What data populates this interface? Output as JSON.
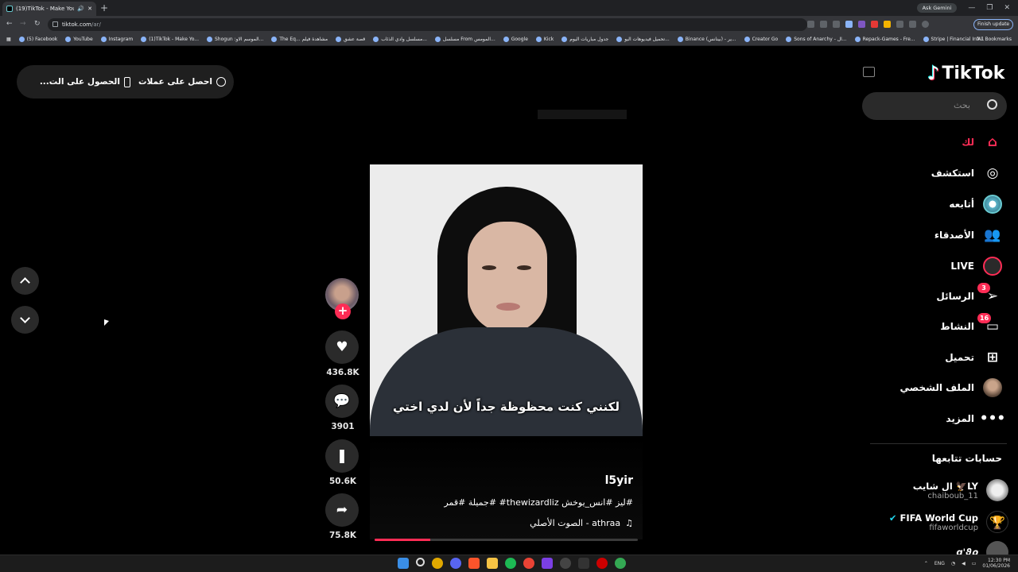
{
  "browser": {
    "tab_title": "(19)TikTok - Make Your Day",
    "ask_gemini": "Ask Gemini",
    "url_host": "tiktok.com",
    "url_path": "/ar/",
    "finish_update": "Finish update",
    "all_bookmarks": "All Bookmarks",
    "bookmarks": [
      "(5) Facebook",
      "YouTube",
      "Instagram",
      "(1)TikTok - Make Yo...",
      "Shogun :الموسم الاو...",
      "The Eq... مشاهدة فيلم",
      "قصة عشق",
      "مسلسل وادي الذئاب...",
      "مسلسل From المومس...",
      "Google",
      "Kick",
      "جدول مباريات اليوم",
      "تحميل فيديوهات اليو...",
      "Binance (بينانس) - ير...",
      "Creator Go",
      "Sons of Anarchy - ال...",
      "Repack-Games - Fre...",
      "Stripe | Financial Infr..."
    ]
  },
  "topbar": {
    "get_coins": "احصل على عملات",
    "get_app": "الحصول على الت..."
  },
  "video": {
    "subtitle": "لكنني كنت محظوظة جداً لأن لدي اختي",
    "author": "l5yir",
    "caption": "#ليز #انس_يوخش thewizardliz# #جميلة #قمر",
    "music": "athraa - الصوت الأصلي",
    "music_icon": "♫",
    "progress": 0.21
  },
  "actions": {
    "likes": "436.8K",
    "comments": "3901",
    "saves": "50.6K",
    "shares": "75.8K"
  },
  "sidebar": {
    "logo": "TikTok",
    "search_placeholder": "بحث",
    "items": [
      {
        "label": "لك",
        "icon": "home-icon"
      },
      {
        "label": "استكشف",
        "icon": "compass-icon"
      },
      {
        "label": "أتابعه",
        "icon": "following-icon"
      },
      {
        "label": "الأصدقاء",
        "icon": "friends-icon"
      },
      {
        "label": "LIVE",
        "icon": "live-icon"
      },
      {
        "label": "الرسائل",
        "icon": "send-icon",
        "badge": "3"
      },
      {
        "label": "النشاط",
        "icon": "activity-icon",
        "badge": "16"
      },
      {
        "label": "تحميل",
        "icon": "plus-square-icon"
      },
      {
        "label": "الملف الشخصي",
        "icon": "profile-avatar"
      },
      {
        "label": "المزيد",
        "icon": "more-icon"
      }
    ],
    "following_heading": "حسابات تتابعها",
    "accounts": [
      {
        "name": "ال شايب 🦅LY",
        "handle": "chaiboub_11"
      },
      {
        "name": "FIFA World Cup",
        "handle": "fifaworldcup"
      },
      {
        "name": "ɑ'ϑρ",
        "handle": ""
      }
    ]
  },
  "taskbar": {
    "lang": "ENG",
    "time": "12:30 PM",
    "date": "01/06/2026"
  },
  "colors": {
    "accent": "#fe2c55",
    "bg": "#000000",
    "panel": "#2a2a2a"
  }
}
